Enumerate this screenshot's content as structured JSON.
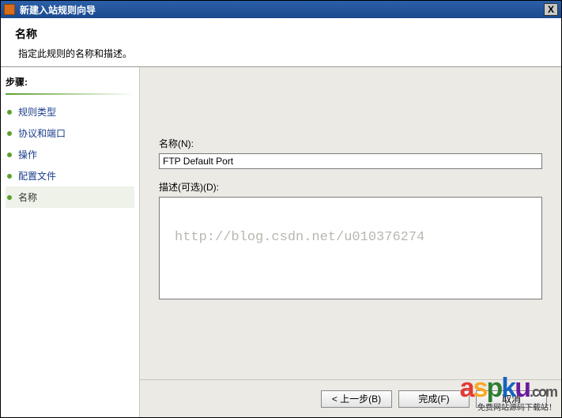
{
  "window": {
    "title": "新建入站规则向导",
    "close": "X"
  },
  "header": {
    "title": "名称",
    "desc": "指定此规则的名称和描述。"
  },
  "sidebar": {
    "heading": "步骤:",
    "items": [
      {
        "label": "规则类型"
      },
      {
        "label": "协议和端口"
      },
      {
        "label": "操作"
      },
      {
        "label": "配置文件"
      },
      {
        "label": "名称"
      }
    ]
  },
  "form": {
    "name_label": "名称(N):",
    "name_value": "FTP Default Port",
    "desc_label": "描述(可选)(D):",
    "desc_value": ""
  },
  "buttons": {
    "back": "< 上一步(B)",
    "finish": "完成(F)",
    "cancel": "取消"
  },
  "watermark": "http://blog.csdn.net/u010376274",
  "overlay": {
    "brand": "aspku",
    "domain": ".com",
    "tagline": "免费网站源码下载站！"
  }
}
